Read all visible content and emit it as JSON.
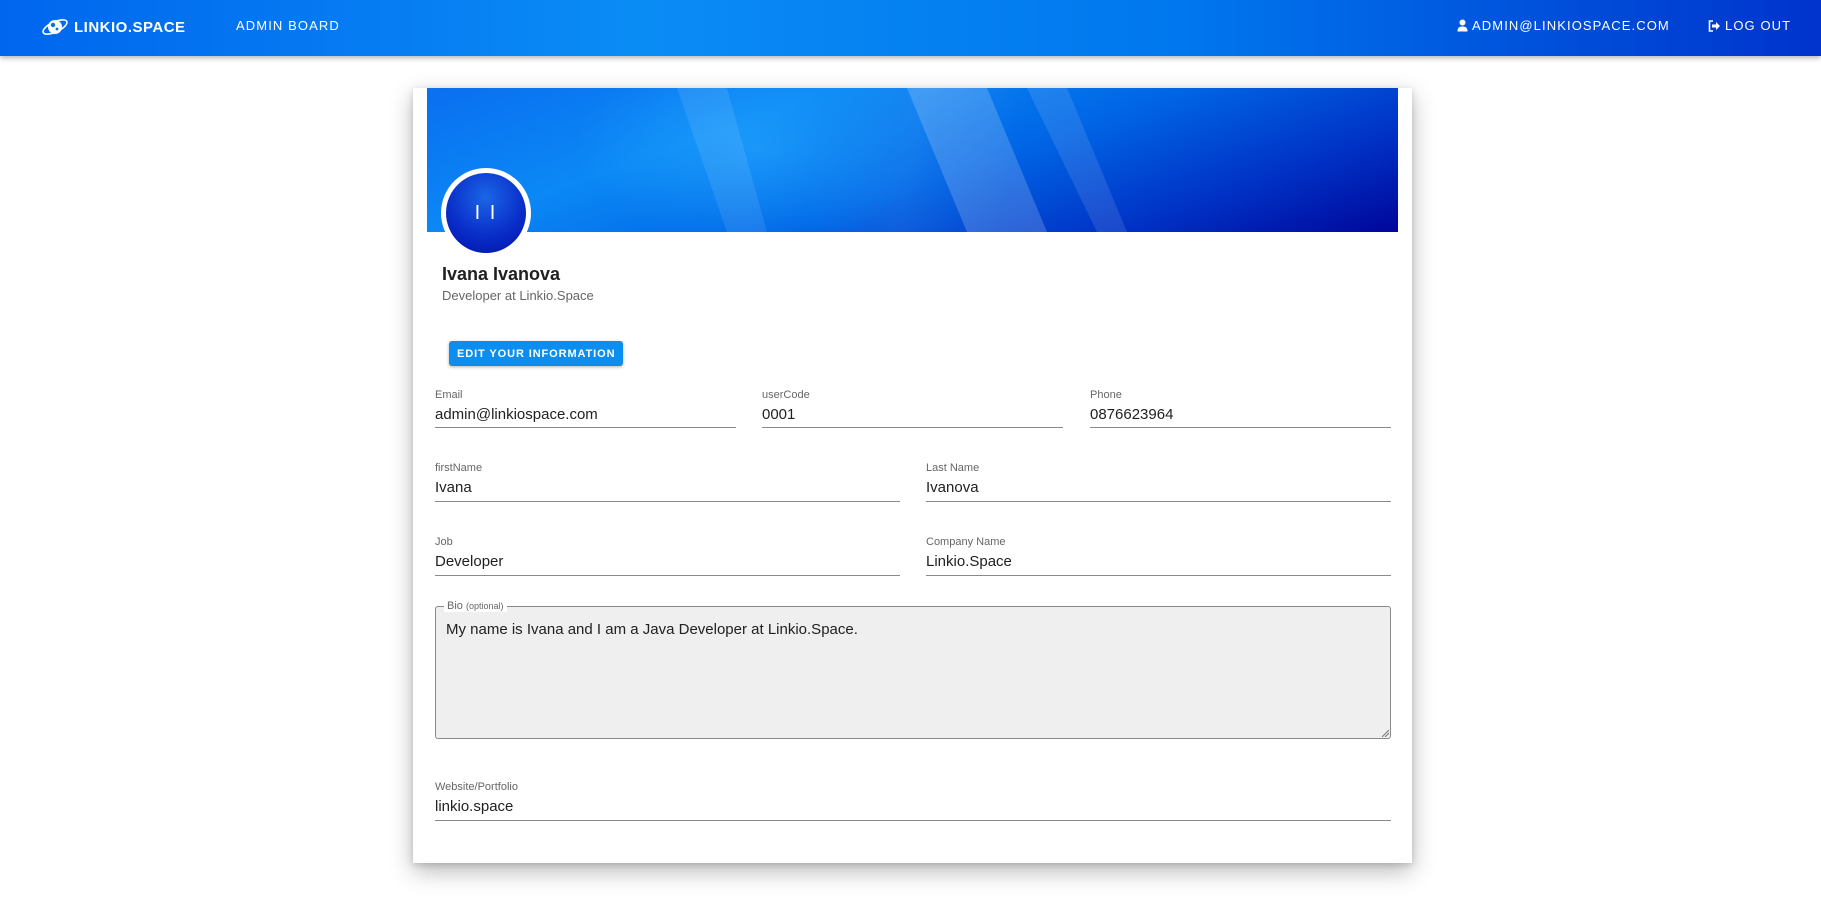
{
  "nav": {
    "brand": "LINKIO.SPACE",
    "admin_board": "ADMIN BOARD",
    "user_email": "ADMIN@LINKIOSPACE.COM",
    "logout": "LOG OUT"
  },
  "profile": {
    "initials": "I I",
    "name": "Ivana Ivanova",
    "subtitle": "Developer at Linkio.Space",
    "edit_button": "EDIT YOUR INFORMATION"
  },
  "fields": {
    "email": {
      "label": "Email",
      "value": "admin@linkiospace.com"
    },
    "user_code": {
      "label": "userCode",
      "value": "0001"
    },
    "phone": {
      "label": "Phone",
      "value": "0876623964"
    },
    "first_name": {
      "label": "firstName",
      "value": "Ivana"
    },
    "last_name": {
      "label": "Last Name",
      "value": "Ivanova"
    },
    "job": {
      "label": "Job",
      "value": "Developer"
    },
    "company": {
      "label": "Company Name",
      "value": "Linkio.Space"
    },
    "bio": {
      "label": "Bio",
      "label_hint": "(optional)",
      "value": "My name is Ivana and I am a Java Developer at Linkio.Space."
    },
    "website": {
      "label": "Website/Portfolio",
      "value": "linkio.space"
    }
  },
  "icons": {
    "brand": "planet-logo-icon",
    "user": "user-icon",
    "logout": "logout-icon"
  },
  "colors": {
    "primary": "#0b8ef0",
    "header_dark": "#0033cc"
  }
}
